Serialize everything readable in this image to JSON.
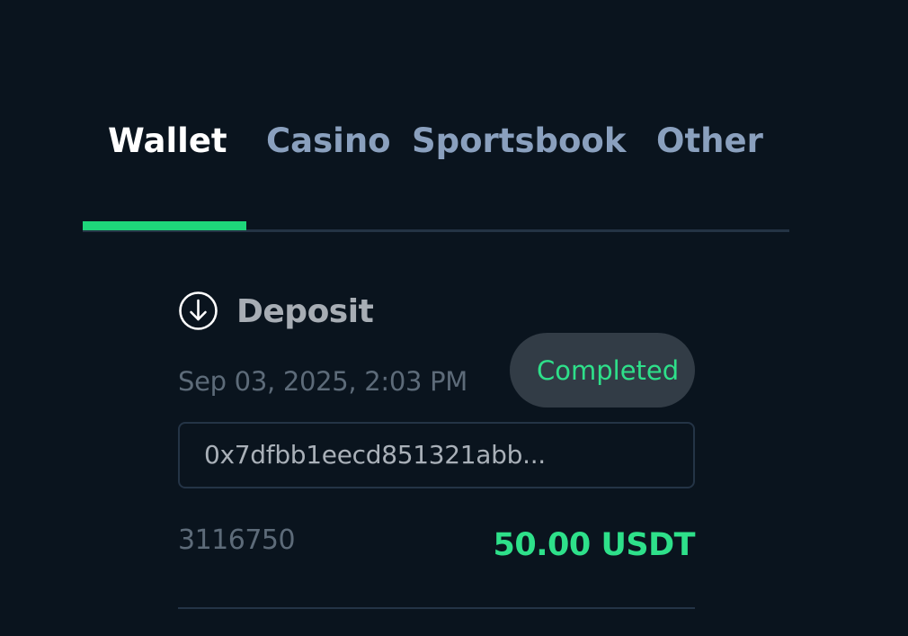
{
  "tabs": [
    {
      "label": "Wallet",
      "active": true
    },
    {
      "label": "Casino",
      "active": false
    },
    {
      "label": "Sportsbook",
      "active": false
    },
    {
      "label": "Other",
      "active": false
    }
  ],
  "transaction": {
    "type_label": "Deposit",
    "type_icon": "arrow-down-circle-icon",
    "date": "Sep 03, 2025, 2:03 PM",
    "status": "Completed",
    "hash": "0x7dfbb1eecd851321abb...",
    "id": "3116750",
    "amount": "50.00 USDT"
  },
  "colors": {
    "background": "#0a141e",
    "accent": "#1ed67a",
    "active_tab": "#ffffff",
    "inactive_tab": "#8aa0be",
    "status_pill": "#323c46"
  }
}
